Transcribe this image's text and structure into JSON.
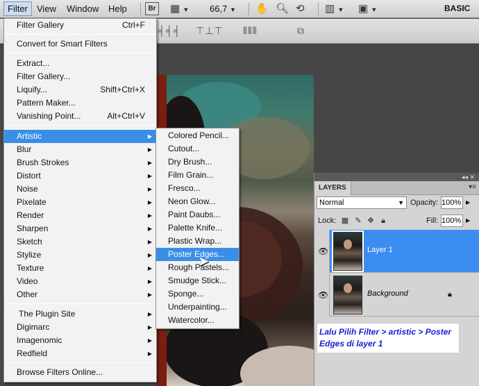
{
  "menubar": {
    "items": [
      "Filter",
      "View",
      "Window",
      "Help"
    ],
    "br_badge": "Br",
    "zoom": "66,7",
    "workspace": "BASIC"
  },
  "filter_menu": {
    "filter_gallery": {
      "label": "Filter Gallery",
      "shortcut": "Ctrl+F"
    },
    "convert_smart": "Convert for Smart Filters",
    "extract": "Extract...",
    "filter_gallery_dots": "Filter Gallery...",
    "liquify": {
      "label": "Liquify...",
      "shortcut": "Shift+Ctrl+X"
    },
    "pattern_maker": "Pattern Maker...",
    "vanishing_point": {
      "label": "Vanishing Point...",
      "shortcut": "Alt+Ctrl+V"
    },
    "categories": [
      "Artistic",
      "Blur",
      "Brush Strokes",
      "Distort",
      "Noise",
      "Pixelate",
      "Render",
      "Sharpen",
      "Sketch",
      "Stylize",
      "Texture",
      "Video",
      "Other"
    ],
    "plugins": [
      "The Plugin Site",
      "Digimarc",
      "Imagenomic",
      "Redfield"
    ],
    "browse_online": "Browse Filters Online..."
  },
  "artistic_submenu": {
    "items": [
      "Colored Pencil...",
      "Cutout...",
      "Dry Brush...",
      "Film Grain...",
      "Fresco...",
      "Neon Glow...",
      "Paint Daubs...",
      "Palette Knife...",
      "Plastic Wrap...",
      "Poster Edges...",
      "Rough Pastels...",
      "Smudge Stick...",
      "Sponge...",
      "Underpainting...",
      "Watercolor..."
    ],
    "highlighted": "Poster Edges..."
  },
  "layers_panel": {
    "tab": "LAYERS",
    "blend_mode": "Normal",
    "opacity_label": "Opacity:",
    "opacity": "100%",
    "lock_label": "Lock:",
    "fill_label": "Fill:",
    "fill": "100%",
    "layers": [
      {
        "name": "Layer 1",
        "selected": true
      },
      {
        "name": "Background",
        "selected": false
      }
    ]
  },
  "note": "Lalu Pilih Filter > artistic > Poster Edges di layer 1",
  "colors": {
    "highlight": "#3a8ee6",
    "note_text": "#1b1bd6"
  }
}
